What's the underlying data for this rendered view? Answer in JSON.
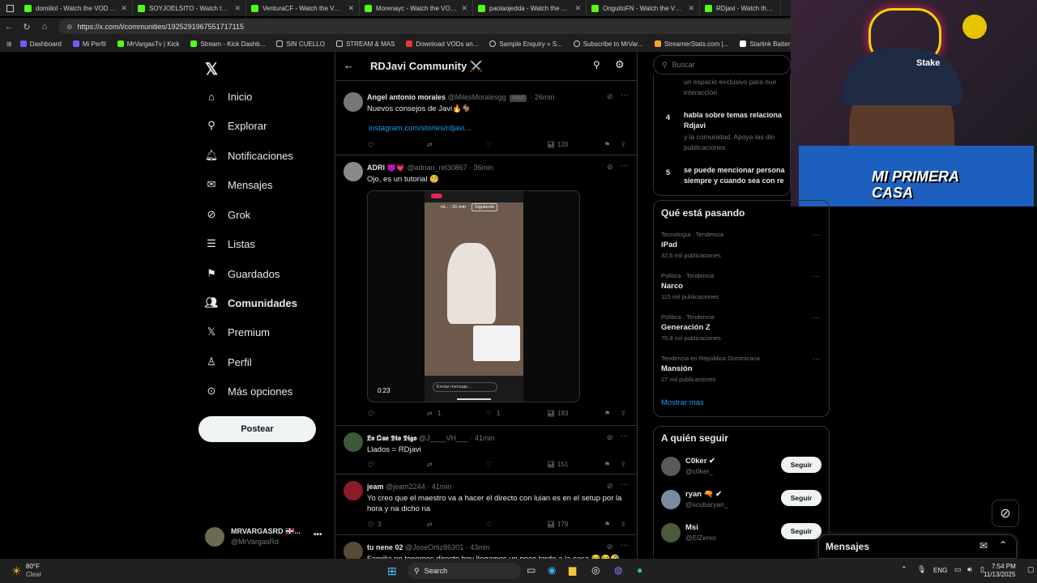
{
  "tabs": [
    "domiilol - Watch the VOD on K",
    "SOYJOELSITO - Watch the VOD",
    "VenturaCF - Watch the VOD on",
    "Morenayc - Watch the VOD on",
    "paolaojedda - Watch the VOD o",
    "OnguitoFN - Watch the VOD o",
    "RDjavi - Watch the VOD o"
  ],
  "url": "https://x.com/i/communities/1925291967551717115",
  "bookmarks": [
    "Dashboard",
    "Mi Perfil",
    "MrVargasTv | Kick",
    "Stream - Kick Dashb...",
    "SIN CUELLO",
    "STREAM & MAS",
    "Download VODs an...",
    "Sample Enquiry » S...",
    "Subscribe to MrVar...",
    "StreamerStats.com |...",
    "Starlink Battery Pow..."
  ],
  "nav": [
    "Inicio",
    "Explorar",
    "Notificaciones",
    "Mensajes",
    "Grok",
    "Listas",
    "Guardados",
    "Comunidades",
    "Premium",
    "Perfil",
    "Más opciones"
  ],
  "post_button": "Postear",
  "account": {
    "name": "MRVARGASRD 🇩🇴...",
    "handle": "@MrVargasRd"
  },
  "community_title": "RDJavi Community ⚔️",
  "tweets": [
    {
      "name": "Angel antonio morales",
      "handle": "@MilesMoralesgg",
      "badge": "Mod",
      "time": "· 26min",
      "text": "Nuevos consejos de Javi🔥🐐",
      "link": "instagram.com/stories/rdjavi...",
      "views": "120"
    },
    {
      "name": "ADRI 😈💗",
      "handle": "@adrian_rel30867",
      "time": "· 36min",
      "text": "Ojo, es un tutorial 🧐",
      "video_time": "0:23",
      "story_user": "rd... · 51 min",
      "story_follow": "Siguiendo",
      "story_msg": "Enviar mensaje...",
      "retweets": "1",
      "likes": "1",
      "views": "183"
    },
    {
      "name": "𝕷𝖔 𝕼𝖚𝖊 𝕯𝖎𝖔 𝕯𝖎𝖌𝖔",
      "handle": "@J____VH___",
      "time": "· 41min",
      "text": "Llados = RDjavi",
      "views": "151"
    },
    {
      "name": "jeam",
      "handle": "@jeam2244",
      "time": "· 41min",
      "text": "Yo creo que el maestro va a hacer el directo con luian es en el setup por la",
      "text2": "hora y na dicho na",
      "replies": "3",
      "views": "179"
    },
    {
      "name": "tu nene 02",
      "handle": "@JoseOrtiz86301",
      "time": "· 43min",
      "text": "Familia no tenemos directo hoy llegamos un poco tarde a la casa 😂😂🤣"
    }
  ],
  "search_placeholder": "Buscar",
  "rules": [
    {
      "text": "un espacio exclusivo para nue",
      "text2": "interacción"
    },
    {
      "num": "4",
      "title": "habla sobre temas relaciona",
      "title2": "Rdjavi",
      "body": "y la comunidad. Apoya las din",
      "body2": "publicaciones"
    },
    {
      "num": "5",
      "title": "se puede mencionar persona",
      "title2": "siempre y cuando sea con re"
    }
  ],
  "trends_title": "Qué está pasando",
  "trends": [
    {
      "cat": "Tecnología · Tendencia",
      "name": "iPad",
      "posts": "32,6 mil publicaciones"
    },
    {
      "cat": "Política · Tendencia",
      "name": "Narco",
      "posts": "115 mil publicaciones"
    },
    {
      "cat": "Política · Tendencia",
      "name": "Generación Z",
      "posts": "70,8 mil publicaciones"
    },
    {
      "cat": "Tendencia en República Dominicana",
      "name": "Mansión",
      "posts": "27 mil publicaciones"
    }
  ],
  "show_more": "Mostrar más",
  "follow_title": "A quién seguir",
  "follow": [
    {
      "name": "C0ker ✔",
      "handle": "@c0ker_",
      "btn": "Seguir"
    },
    {
      "name": "ryan 🔫 ✔",
      "handle": "@scubaryan_",
      "btn": "Seguir"
    },
    {
      "name": "Msi",
      "handle": "@ElZerxo",
      "btn": "Seguir"
    }
  ],
  "messages": "Mensajes",
  "cam_logo": "MI PRIMERA CASA",
  "cam_cap": "Stake",
  "weather": {
    "temp": "80°F",
    "desc": "Clear"
  },
  "taskbar_search": "Search",
  "tray": {
    "lang": "ENG",
    "time": "7:54 PM",
    "date": "11/13/2025"
  },
  "colors": {
    "accent": "#1d9bf0",
    "kick": "#53fc18"
  }
}
